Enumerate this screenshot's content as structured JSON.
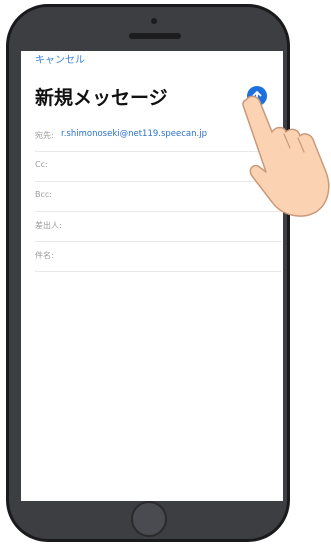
{
  "header": {
    "cancel_label": "キャンセル",
    "title": "新規メッセージ",
    "send_icon": "arrow-up-icon"
  },
  "fields": {
    "to_label": "宛先:",
    "to_value": "r.shimonoseki@net119.speecan.jp",
    "cc_label": "Cc:",
    "bcc_label": "Bcc:",
    "from_label": "差出人:",
    "subject_label": "件名:"
  },
  "colors": {
    "accent": "#1e6fe0",
    "link": "#3a84d6",
    "phone_body": "#3d3e42"
  }
}
